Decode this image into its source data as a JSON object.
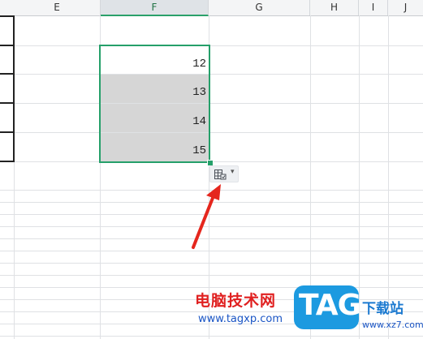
{
  "columns": [
    "E",
    "F",
    "G",
    "H",
    "I",
    "J"
  ],
  "active_column": "F",
  "cells": [
    "12",
    "13",
    "14",
    "15"
  ],
  "quick_button": {
    "icon": "paste-options-icon",
    "chevron": "▾"
  },
  "watermark": {
    "cn_text": "电脑技术网",
    "url_left": "www.tagxp.com",
    "logo_text": "TAG",
    "right_text": "下载站",
    "url_right": "www.xz7.com"
  },
  "colors": {
    "selection": "#25a06a",
    "arrow": "#e5261d",
    "shade": "#d6d6d6"
  }
}
